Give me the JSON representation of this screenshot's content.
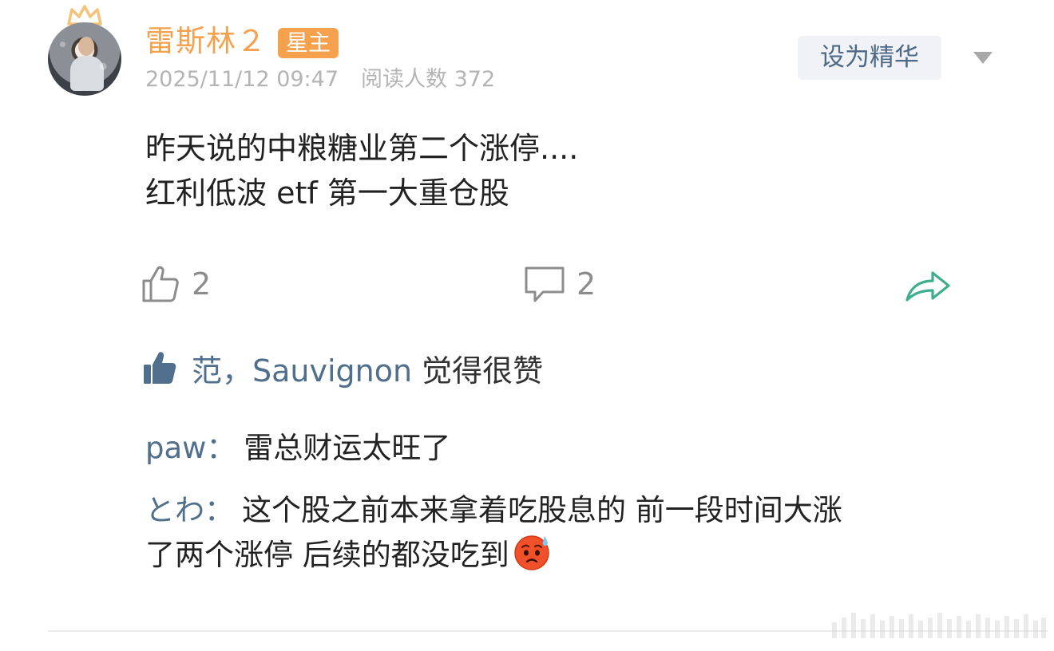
{
  "user": {
    "name": "雷斯林２",
    "badge": "星主",
    "timestamp": "2025/11/12 09:47",
    "read_count": "阅读人数 372"
  },
  "header": {
    "feature_button_label": "设为精华",
    "dropdown_icon": "chevron-down-icon"
  },
  "post": {
    "lines": [
      "昨天说的中粮糖业第二个涨停....",
      "红利低波 etf 第一大重仓股"
    ]
  },
  "actions": {
    "like_count": "2",
    "comment_count": "2",
    "share_icon": "share-arrow-icon"
  },
  "likes": {
    "names": "范，Sauvignon",
    "suffix": "觉得很赞"
  },
  "comments": [
    {
      "author": "paw",
      "colon": "：",
      "text": "雷总财运太旺了"
    },
    {
      "author": "とわ",
      "colon": "：",
      "line1": "这个股之前本来拿着吃股息的 前一段时间大涨",
      "line2": "了两个涨停 后续的都没吃到",
      "emoji": "sweat-face-emoji"
    }
  ],
  "colors": {
    "username": "#f6a14e",
    "link": "#506f8c",
    "share": "#3dae8e",
    "muted": "#b4b4b4"
  }
}
